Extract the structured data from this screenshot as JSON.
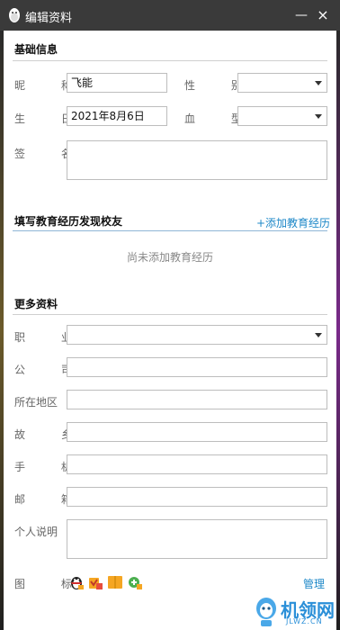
{
  "window": {
    "title": "编辑资料",
    "minimize": "—",
    "close": "×"
  },
  "basic": {
    "section_title": "基础信息",
    "nickname_label": "昵 称",
    "nickname_value": "飞能",
    "gender_label": "性 别",
    "gender_value": "",
    "birthday_label": "生 日",
    "birthday_value": "2021年8月6日",
    "blood_label": "血 型",
    "blood_value": "",
    "signature_label": "签 名"
  },
  "education": {
    "section_title": "填写教育经历发现校友",
    "add_link": "+添加教育经历",
    "empty_text": "尚未添加教育经历"
  },
  "more": {
    "section_title": "更多资料",
    "occupation_label": "职 业",
    "company_label": "公 司",
    "location_label": "所在地区",
    "hometown_label": "故 乡",
    "phone_label": "手 机",
    "email_label": "邮 箱",
    "bio_label": "个人说明",
    "icons_label": "图 标",
    "manage_link": "管理"
  },
  "icons": [
    "qq-penguin-icon",
    "vip-badge-icon",
    "book-icon",
    "game-badge-icon"
  ],
  "watermark": {
    "brand": "机领网",
    "url": "JLWZ.CN"
  },
  "colors": {
    "titlebar": "#3a3a3a",
    "link": "#1e88c8"
  }
}
